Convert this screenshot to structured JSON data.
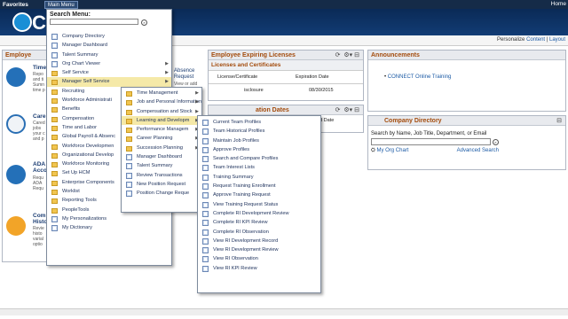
{
  "topbar": {
    "favorites": "Favorites",
    "main_menu": "Main Menu",
    "home": "Home"
  },
  "personalize": {
    "prefix": "Personalize",
    "content": "Content",
    "layout": "Layout"
  },
  "left_pagelets": {
    "header": "Employe",
    "items": [
      {
        "title": "Time",
        "lines": [
          "Repo",
          "and ti",
          "Sumn",
          "time p"
        ]
      },
      {
        "title": "Care",
        "lines": [
          "Cared",
          "jobs ",
          "your c",
          "and p"
        ]
      },
      {
        "title": "ADA Acco",
        "lines": [
          "Requ",
          "ADA ",
          "Requ"
        ]
      },
      {
        "title": "Com Histo",
        "lines": [
          "Revie",
          "histo",
          "varial",
          "optio"
        ]
      }
    ]
  },
  "absence": {
    "title": "Absence Request",
    "line": "View or add"
  },
  "expiring": {
    "header": "Employee Expiring Licenses",
    "subheader": "Licenses and Certificates",
    "col1": "License/Certificate",
    "col2": "Expiration Date",
    "row_value": "isclosure",
    "row_date": "08/30/2015"
  },
  "training": {
    "header": "ation Dates",
    "col2": "nd Date"
  },
  "announcements": {
    "header": "Announcements",
    "item": "CONNECT Online Training"
  },
  "directory": {
    "header": "Company Directory",
    "search_label": "Search by Name, Job Title, Department, or Email",
    "org_chart": "My Org Chart",
    "advanced": "Advanced Search"
  },
  "search_menu": {
    "label": "Search Menu:",
    "go": "»",
    "items": [
      {
        "label": "Company Directory",
        "icon": "doc",
        "arrow": false
      },
      {
        "label": "Manager Dashboard",
        "icon": "doc",
        "arrow": false
      },
      {
        "label": "Talent Summary",
        "icon": "doc",
        "arrow": false
      },
      {
        "label": "Org Chart Viewer",
        "icon": "doc",
        "arrow": true
      },
      {
        "label": "Self Service",
        "icon": "folder",
        "arrow": true
      },
      {
        "label": "Manager Self Service",
        "icon": "folder",
        "arrow": true,
        "hl": true
      },
      {
        "label": "Recruiting",
        "icon": "folder",
        "arrow": true
      },
      {
        "label": "Workforce Administrati",
        "icon": "folder",
        "arrow": true
      },
      {
        "label": "Benefits",
        "icon": "folder",
        "arrow": true
      },
      {
        "label": "Compensation",
        "icon": "folder",
        "arrow": true
      },
      {
        "label": "Time and Labor",
        "icon": "folder",
        "arrow": true
      },
      {
        "label": "Global Payroll & Absenc",
        "icon": "folder",
        "arrow": true
      },
      {
        "label": "Workforce Developmen",
        "icon": "folder",
        "arrow": true
      },
      {
        "label": "Organizational Develop",
        "icon": "folder",
        "arrow": true
      },
      {
        "label": "Workforce Monitoring",
        "icon": "folder",
        "arrow": true
      },
      {
        "label": "Set Up HCM",
        "icon": "folder",
        "arrow": true
      },
      {
        "label": "Enterprise Components",
        "icon": "folder",
        "arrow": true
      },
      {
        "label": "Worklist",
        "icon": "folder",
        "arrow": true
      },
      {
        "label": "Reporting Tools",
        "icon": "folder",
        "arrow": true
      },
      {
        "label": "PeopleTools",
        "icon": "folder",
        "arrow": true
      },
      {
        "label": "My Personalizations",
        "icon": "doc",
        "arrow": false
      },
      {
        "label": "My Dictionary",
        "icon": "doc",
        "arrow": false
      }
    ]
  },
  "mss_menu": {
    "items": [
      {
        "label": "Time Management",
        "icon": "folder",
        "arrow": true
      },
      {
        "label": "Job and Personal Information",
        "icon": "folder",
        "arrow": true
      },
      {
        "label": "Compensation and Stock",
        "icon": "folder",
        "arrow": true
      },
      {
        "label": "Learning and Developm",
        "icon": "folder",
        "arrow": true,
        "hl": true
      },
      {
        "label": "Performance Managem",
        "icon": "folder",
        "arrow": true
      },
      {
        "label": "Career Planning",
        "icon": "folder",
        "arrow": true
      },
      {
        "label": "Succession Planning",
        "icon": "folder",
        "arrow": true
      },
      {
        "label": "Manager Dashboard",
        "icon": "doc",
        "arrow": false
      },
      {
        "label": "Talent Summary",
        "icon": "doc",
        "arrow": false
      },
      {
        "label": "Review Transactions",
        "icon": "doc",
        "arrow": false
      },
      {
        "label": "New Position Request",
        "icon": "doc",
        "arrow": false
      },
      {
        "label": "Position Change Reque",
        "icon": "doc",
        "arrow": false
      }
    ]
  },
  "ld_menu": {
    "items": [
      {
        "label": "Current Team Profiles",
        "icon": "doc"
      },
      {
        "label": "Team Historical Profiles",
        "icon": "doc"
      },
      {
        "label": "Maintain Job Profiles",
        "icon": "doc"
      },
      {
        "label": "Approve Profiles",
        "icon": "doc"
      },
      {
        "label": "Search and Compare Profiles",
        "icon": "doc"
      },
      {
        "label": "Team Interest Lists",
        "icon": "doc"
      },
      {
        "label": "Training Summary",
        "icon": "doc"
      },
      {
        "label": "Request Training Enrollment",
        "icon": "doc"
      },
      {
        "label": "Approve Training Request",
        "icon": "doc"
      },
      {
        "label": "View Training Request Status",
        "icon": "doc"
      },
      {
        "label": "Complete RI Development Review",
        "icon": "doc"
      },
      {
        "label": "Complete RI KPI Review",
        "icon": "doc"
      },
      {
        "label": "Complete RI Observation",
        "icon": "doc"
      },
      {
        "label": "View RI Development Record",
        "icon": "doc"
      },
      {
        "label": "View RI Development Review",
        "icon": "doc"
      },
      {
        "label": "View RI Observation",
        "icon": "doc"
      },
      {
        "label": "View RI KPI Review",
        "icon": "doc"
      }
    ]
  }
}
